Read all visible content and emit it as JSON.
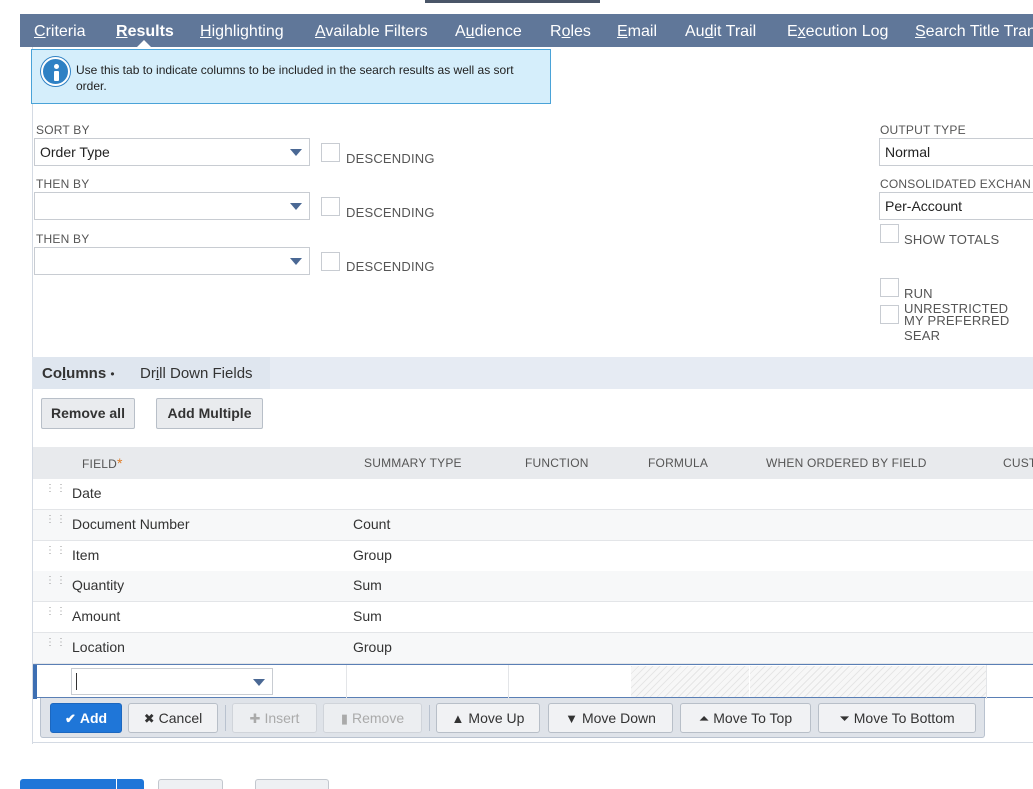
{
  "tabs": [
    {
      "pre": "",
      "u": "C",
      "post": "riteria",
      "active": false
    },
    {
      "pre": "",
      "u": "R",
      "post": "esults",
      "active": true
    },
    {
      "pre": "",
      "u": "H",
      "post": "ighlighting",
      "active": false
    },
    {
      "pre": "",
      "u": "A",
      "post": "vailable Filters",
      "active": false
    },
    {
      "pre": "A",
      "u": "u",
      "post": "dience",
      "active": false
    },
    {
      "pre": "R",
      "u": "o",
      "post": "les",
      "active": false
    },
    {
      "pre": "",
      "u": "E",
      "post": "mail",
      "active": false
    },
    {
      "pre": "Au",
      "u": "d",
      "post": "it Trail",
      "active": false
    },
    {
      "pre": "E",
      "u": "x",
      "post": "ecution Log",
      "active": false
    },
    {
      "pre": "",
      "u": "S",
      "post": "earch Title Tran",
      "active": false
    }
  ],
  "info": {
    "text": "Use this tab to indicate columns to be included in the search results as well as sort order."
  },
  "sort": {
    "sort_by_label": "SORT BY",
    "sort_by_value": "Order Type",
    "then_by_label_1": "THEN BY",
    "then_by_value_1": "",
    "then_by_label_2": "THEN BY",
    "then_by_value_2": "",
    "descending_label": "DESCENDING"
  },
  "options": {
    "output_type_label": "OUTPUT TYPE",
    "output_type_value": "Normal",
    "consolidated_label": "CONSOLIDATED EXCHAN",
    "consolidated_value": "Per-Account",
    "show_totals_label": "SHOW TOTALS",
    "run_unrestricted_label": "RUN UNRESTRICTED",
    "preferred_search_label": "MY PREFERRED SEAR"
  },
  "subtabs": {
    "columns_pre": "Co",
    "columns_u": "l",
    "columns_post": "umns",
    "bullet": "•",
    "drill_pre": "Dr",
    "drill_u": "i",
    "drill_post": "ll Down Fields"
  },
  "buttons": {
    "remove_all": "Remove all",
    "add_multiple": "Add Multiple"
  },
  "table": {
    "headers": {
      "field": "FIELD",
      "required_mark": "*",
      "summary_type": "SUMMARY TYPE",
      "function": "FUNCTION",
      "formula": "FORMULA",
      "when_ordered": "WHEN ORDERED BY FIELD",
      "custom": "CUSTO"
    },
    "rows": [
      {
        "field": "Date",
        "summary": ""
      },
      {
        "field": "Document Number",
        "summary": "Count"
      },
      {
        "field": "Item",
        "summary": "Group"
      },
      {
        "field": "Quantity",
        "summary": "Sum"
      },
      {
        "field": "Amount",
        "summary": "Sum"
      },
      {
        "field": "Location",
        "summary": "Group"
      }
    ],
    "drag_glyph": "⋮⋮"
  },
  "actions": {
    "add": "Add",
    "cancel": "Cancel",
    "insert": "Insert",
    "remove": "Remove",
    "move_up": "Move Up",
    "move_down": "Move Down",
    "move_to_top": "Move To Top",
    "move_to_bottom": "Move To Bottom"
  },
  "icons": {
    "add": "check-icon",
    "cancel": "x-icon",
    "insert": "plus-icon",
    "remove": "trash-icon",
    "move_up": "arrow-up-icon",
    "move_down": "arrow-down-icon",
    "move_to_top": "arrow-top-icon",
    "move_to_bottom": "arrow-bottom-icon"
  },
  "colors": {
    "tab_bar": "#607799",
    "primary_button": "#1f76d8",
    "info_background": "#d5eefb",
    "required_star": "#e07a22"
  }
}
